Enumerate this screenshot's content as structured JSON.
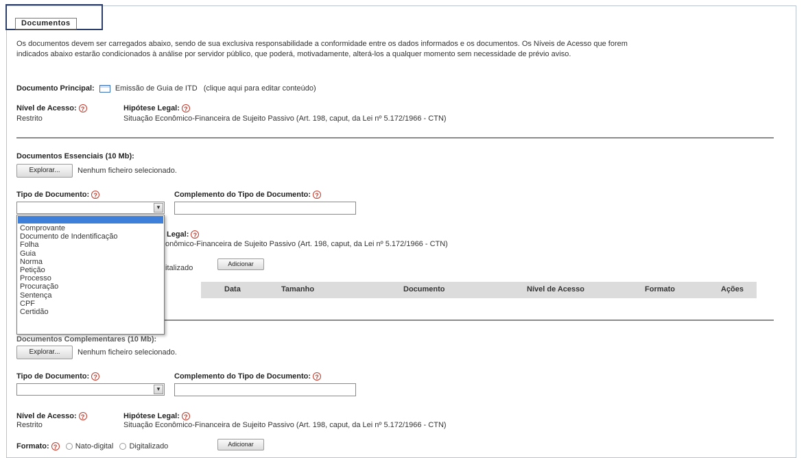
{
  "section": {
    "title": "Documentos"
  },
  "intro": {
    "line1": "Os documentos devem ser carregados abaixo, sendo de sua exclusiva responsabilidade a conformidade entre os dados informados e os documentos. Os Níveis de Acesso que forem",
    "line2": "indicados abaixo estarão condicionados à análise por servidor público, que poderá, motivadamente, alterá-los a qualquer momento sem necessidade de prévio aviso."
  },
  "principal": {
    "label": "Documento Principal:",
    "doc_name": "Emissão de Guia de ITD",
    "edit_hint": "(clique aqui para editar conteúdo)",
    "nivel_label": "Nível de Acesso:",
    "nivel_value": "Restrito",
    "hipotese_label": "Hipótese Legal:",
    "hipotese_value": "Situação Econômico-Financeira de Sujeito Passivo (Art. 198, caput, da Lei nº 5.172/1966 - CTN)"
  },
  "essenciais": {
    "label": "Documentos Essenciais (10 Mb):",
    "browse_label": "Explorar...",
    "no_file": "Nenhum ficheiro selecionado.",
    "tipo_label": "Tipo de Documento:",
    "complemento_label": "Complemento do Tipo de Documento:",
    "hipotese_partial": "Legal:",
    "hipotese_value_partial": "onômico-Financeira de Sujeito Passivo (Art. 198, caput, da Lei nº 5.172/1966 - CTN)",
    "formato_partial": "italizado",
    "add_label": "Adicionar"
  },
  "dropdown": {
    "options": [
      "Comprovante",
      "Documento de Indentificação",
      "Folha",
      "Guia",
      "Norma",
      "Petição",
      "Processo",
      "Procuração",
      "Sentença",
      "CPF",
      "Certidão"
    ]
  },
  "table": {
    "headers": [
      "Data",
      "Tamanho",
      "Documento",
      "Nível de Acesso",
      "Formato",
      "Ações"
    ]
  },
  "complementares": {
    "label": "Documentos Complementares (10 Mb):",
    "browse_label": "Explorar...",
    "no_file": "Nenhum ficheiro selecionado.",
    "tipo_label": "Tipo de Documento:",
    "complemento_label": "Complemento do Tipo de Documento:",
    "nivel_label": "Nível de Acesso:",
    "nivel_value": "Restrito",
    "hipotese_label": "Hipótese Legal:",
    "hipotese_value": "Situação Econômico-Financeira de Sujeito Passivo (Art. 198, caput, da Lei nº 5.172/1966 - CTN)",
    "formato_label": "Formato:",
    "nato_digital": "Nato-digital",
    "digitalizado": "Digitalizado",
    "add_label": "Adicionar"
  },
  "icons": {
    "help": "?",
    "dropdown_arrow": "▼"
  },
  "colors": {
    "help": "#c0392b",
    "selection": "#3d7fd9",
    "frame_highlight": "#2b3e6b"
  }
}
